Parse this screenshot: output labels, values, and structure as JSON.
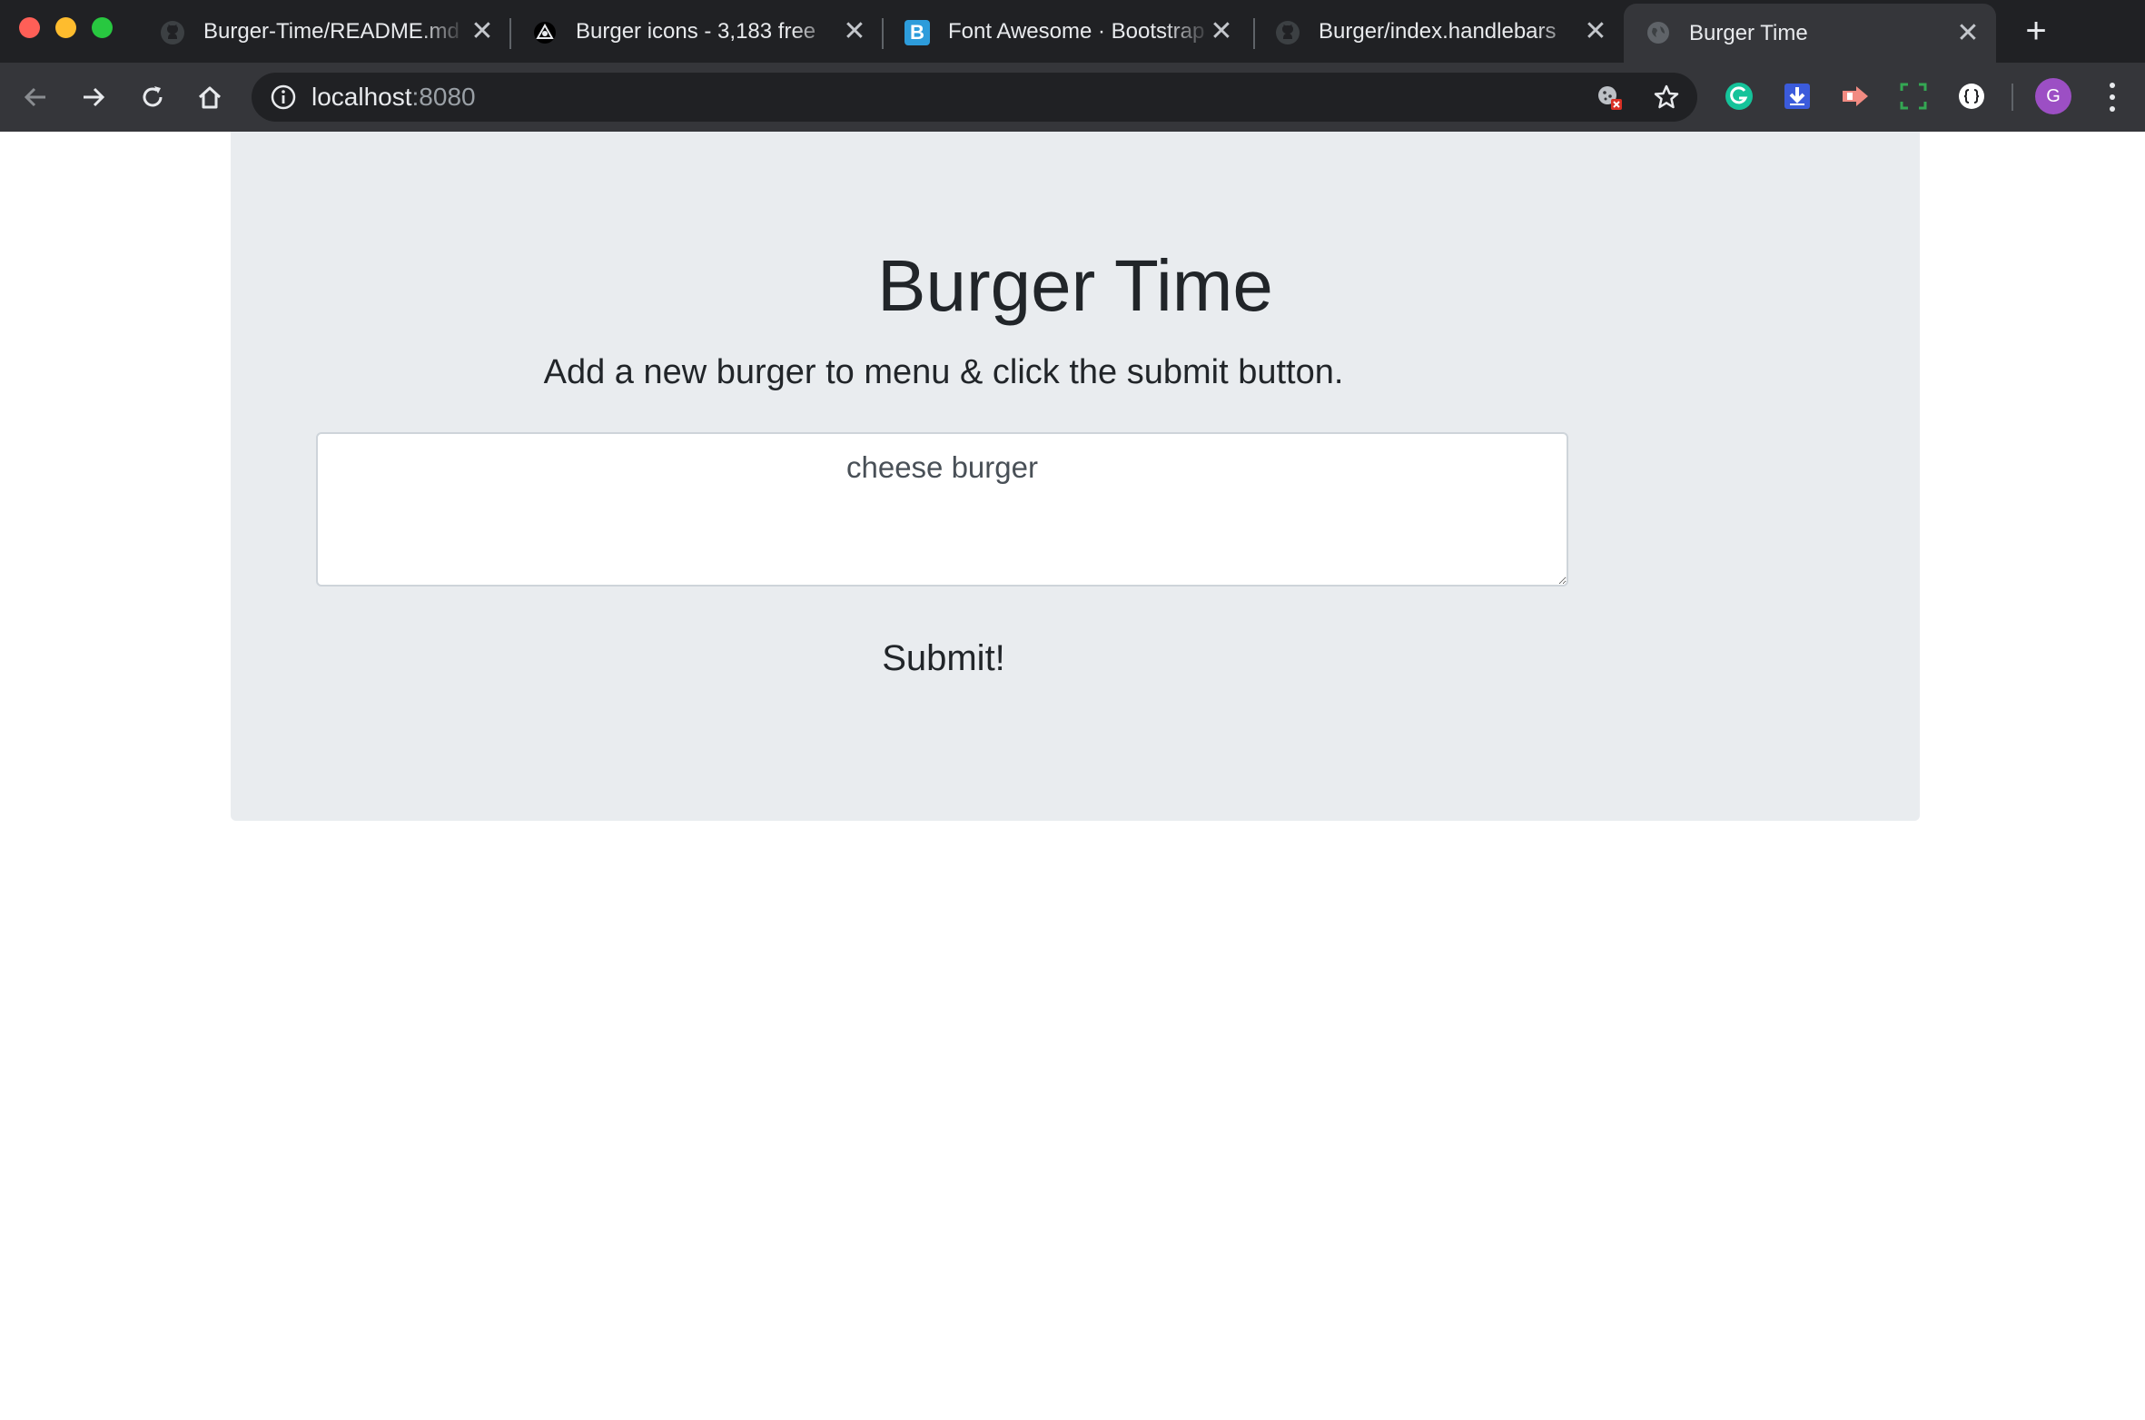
{
  "browser": {
    "tabs": [
      {
        "title": "Burger-Time/README.md",
        "favicon": "github-icon",
        "active": false
      },
      {
        "title": "Burger icons - 3,183 free",
        "favicon": "noun-project-icon",
        "active": false
      },
      {
        "title": "Font Awesome · Bootstrap",
        "favicon": "bootstrap-icon",
        "favicon_letter": "B",
        "active": false
      },
      {
        "title": "Burger/index.handlebars",
        "favicon": "github-icon",
        "active": false
      },
      {
        "title": "Burger Time",
        "favicon": "globe-icon",
        "active": true
      }
    ],
    "new_tab_label": "+",
    "close_glyph": "✕",
    "address": {
      "host": "localhost",
      "port": ":8080"
    },
    "profile_initial": "G",
    "colors": {
      "tab_strip": "#202124",
      "toolbar": "#35363a",
      "profile": "#9c4fc4"
    }
  },
  "page": {
    "title": "Burger Time",
    "lead": "Add a new burger to menu & click the submit button.",
    "burger_input": {
      "value": "cheese burger"
    },
    "submit_label": "Submit!",
    "colors": {
      "jumbotron_bg": "#e9ecef",
      "text": "#212529"
    }
  }
}
